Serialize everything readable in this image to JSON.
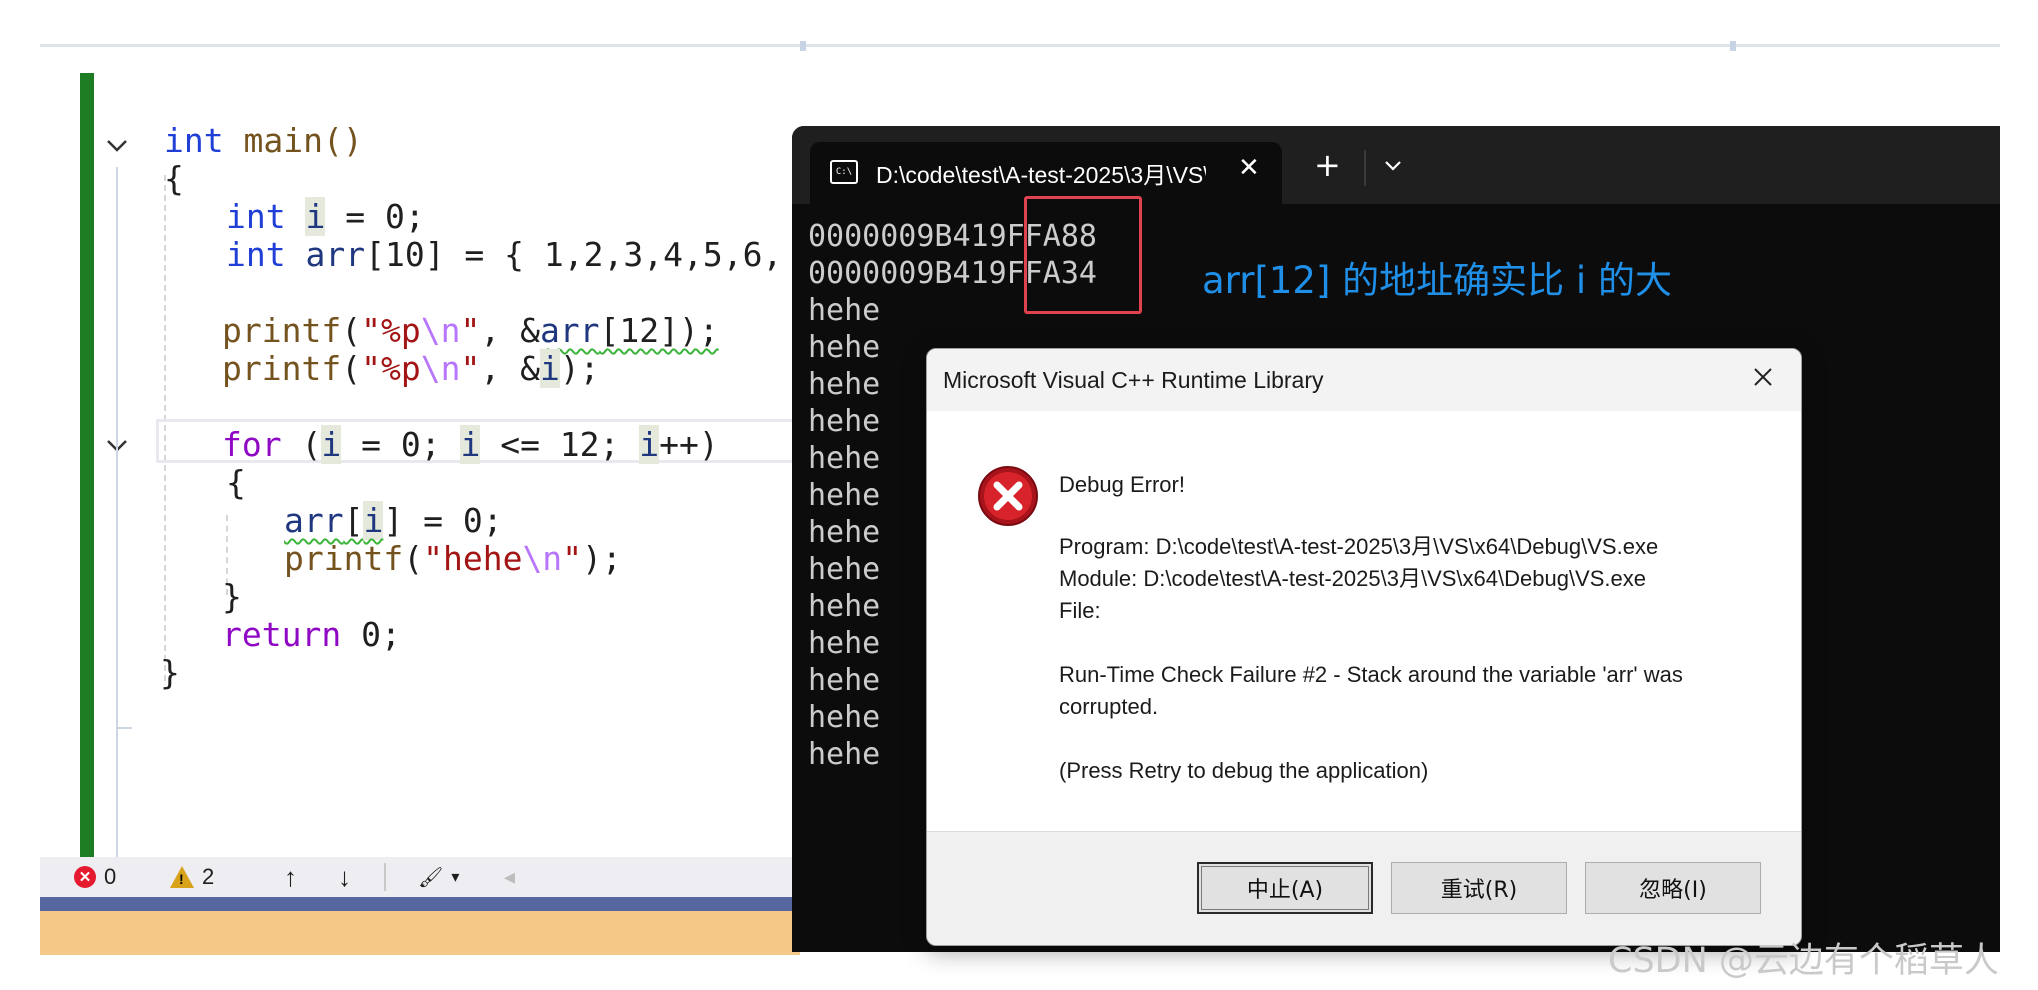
{
  "editor": {
    "code_lines": {
      "l1_kw": "int",
      "l1_rest": " main()",
      "l2": "{",
      "l3_kw": "int",
      "l3_var": "i",
      "l3_rest": " = 0;",
      "l4_kw": "int",
      "l4_var": " arr",
      "l4_rest": "[10] = { 1,2,3,4,5,6,",
      "l5_fn": "printf",
      "l5_open": "(",
      "l5_str1": "\"%p",
      "l5_esc": "\\n",
      "l5_str2": "\"",
      "l5_mid": ", &",
      "l5_var": "arr",
      "l5_rest": "[12]);",
      "l6_fn": "printf",
      "l6_open": "(",
      "l6_str1": "\"%p",
      "l6_esc": "\\n",
      "l6_str2": "\"",
      "l6_mid": ", &",
      "l6_var": "i",
      "l6_rest": ");",
      "l7_kw": "for",
      "l7_a": " (",
      "l7_v1": "i",
      "l7_b": " = 0; ",
      "l7_v2": "i",
      "l7_c": " <= 12; ",
      "l7_v3": "i",
      "l7_d": "++)",
      "l8": "{",
      "l9_var": "arr",
      "l9_a": "[",
      "l9_i": "i",
      "l9_b": "] = 0;",
      "l10_fn": "printf",
      "l10_open": "(",
      "l10_str1": "\"hehe",
      "l10_esc": "\\n",
      "l10_str2": "\"",
      "l10_rest": ");",
      "l11": "}",
      "l12_kw": "return",
      "l12_rest": " 0;",
      "l13": "}"
    },
    "status": {
      "errors": "0",
      "warnings": "2",
      "up": "↑",
      "down": "↓",
      "brush": "🖌",
      "caret": "▾",
      "left": "◂"
    }
  },
  "terminal": {
    "tab_title": "D:\\code\\test\\A-test-2025\\3月\\VS\\x64\\Debug\\VS.exe",
    "tab_icon": "C:\\",
    "close": "✕",
    "plus": "+",
    "output": "0000009B419FFA88\n0000009B419FFA34\nhehe\nhehe\nhehe\nhehe\nhehe\nhehe\nhehe\nhehe\nhehe\nhehe\nhehe\nhehe\nhehe"
  },
  "annotation": "arr[12] 的地址确实比 i 的大",
  "dialog": {
    "title": "Microsoft Visual C++ Runtime Library",
    "heading": "Debug Error!",
    "program": "Program: D:\\code\\test\\A-test-2025\\3月\\VS\\x64\\Debug\\VS.exe",
    "module": "Module: D:\\code\\test\\A-test-2025\\3月\\VS\\x64\\Debug\\VS.exe",
    "file": "File:",
    "message1": "Run-Time Check Failure #2 - Stack around the variable 'arr' was",
    "message2": "corrupted.",
    "hint": "(Press Retry to debug the application)",
    "buttons": {
      "abort": "中止(A)",
      "retry": "重试(R)",
      "ignore": "忽略(I)"
    }
  },
  "watermark": "CSDN @云边有个稻草人",
  "colors": {
    "gutter": "#1e7d23",
    "keyword": "#1f3fd6",
    "string": "#a31515",
    "annotation": "#1f8fe8",
    "highlight_box": "#e0424f"
  }
}
